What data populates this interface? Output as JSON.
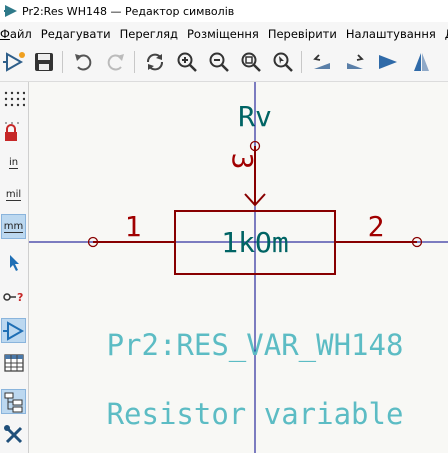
{
  "window": {
    "title": "Pr2:Res WH148 — Редактор символів"
  },
  "menu": {
    "items": [
      {
        "label": "Файл",
        "underline": "Ф"
      },
      {
        "label": "Редагувати"
      },
      {
        "label": "Перегляд"
      },
      {
        "label": "Розміщення"
      },
      {
        "label": "Перевірити"
      },
      {
        "label": "Налаштування"
      },
      {
        "label": "До"
      }
    ]
  },
  "toolbar": {
    "icons": [
      "new-symbol-icon",
      "save-icon",
      "undo-icon",
      "redo-icon",
      "refresh-icon",
      "zoom-in-icon",
      "zoom-out-icon",
      "zoom-fit-icon",
      "zoom-selection-icon",
      "rotate-ccw-icon",
      "rotate-cw-icon",
      "mirror-horizontal-icon",
      "mirror-vertical-icon"
    ]
  },
  "left_toolbar": {
    "units": {
      "inch": "in",
      "mil": "mil",
      "mm": "mm"
    }
  },
  "symbol": {
    "reference": "Rv",
    "value": "1kOm",
    "footprint_name": "Pr2:RES_VAR_WH148",
    "description": "Resistor variable",
    "pins": [
      {
        "number": "1"
      },
      {
        "number": "2"
      },
      {
        "number": "3"
      }
    ]
  },
  "colors": {
    "body": "#880000",
    "pin_number": "#a00000",
    "reference": "#006464",
    "value": "#006464",
    "field_hidden": "#5cbcc4",
    "axis": "#00008b",
    "accent": "#1f6fb5"
  }
}
